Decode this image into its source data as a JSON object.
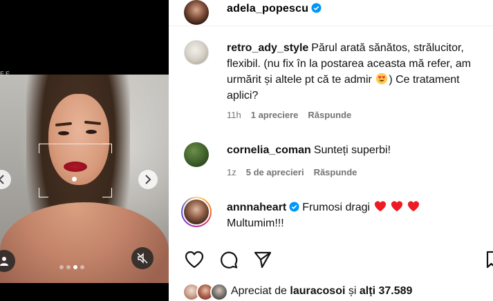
{
  "post": {
    "author": "adela_popescu",
    "media": {
      "rec_indicator": "EE",
      "slide_count": 4,
      "active_slide": 3
    }
  },
  "comments": [
    {
      "user": "retro_ady_style",
      "text_before_emoji": "Părul arată sănătos, strălucitor, flexibil. (nu fix în la postarea aceasta mă refer, am urmărit și altele pt că te admir",
      "emoji": "heart-eyes-emoji",
      "text_after_emoji": ") Ce tratament aplici?",
      "time": "11h",
      "likes": "1 apreciere",
      "reply": "Răspunde"
    },
    {
      "user": "cornelia_coman",
      "text": "Sunteți superbi!",
      "time": "1z",
      "likes": "5 de aprecieri",
      "reply": "Răspunde"
    },
    {
      "user": "annnaheart",
      "text": "Frumosi dragi",
      "hearts": 3,
      "text2": "Multumim!!!"
    }
  ],
  "footer": {
    "liked_prefix": "Apreciat de",
    "liked_user": "lauracosoi",
    "liked_and": "și",
    "liked_others": "alți 37.589"
  },
  "colors": {
    "verified": "#0095f6",
    "heart": "#ed1c24",
    "meta": "#737373"
  }
}
